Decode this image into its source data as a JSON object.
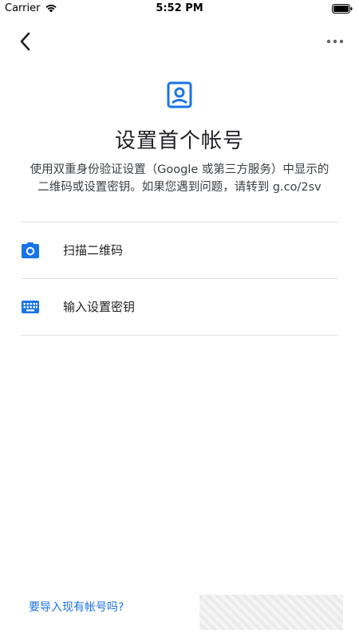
{
  "status_bar": {
    "carrier": "Carrier",
    "time": "5:52 PM"
  },
  "nav": {
    "back_icon": "chevron-left-icon",
    "more_icon": "more-horizontal-icon"
  },
  "header": {
    "icon": "account-box-icon",
    "title": "设置首个帐号",
    "description_line1": "使用双重身份验证设置（Google 或第三方服务）中显示的",
    "description_line2": "二维码或设置密钥。如果您遇到问题，请转到 g.co/2sv"
  },
  "options": [
    {
      "icon": "camera-icon",
      "label": "扫描二维码"
    },
    {
      "icon": "keyboard-icon",
      "label": "输入设置密钥"
    }
  ],
  "footer": {
    "import_link": "要导入现有帐号吗?"
  },
  "colors": {
    "accent": "#1a73e8",
    "text": "#202124",
    "divider": "#e0e0e0"
  }
}
